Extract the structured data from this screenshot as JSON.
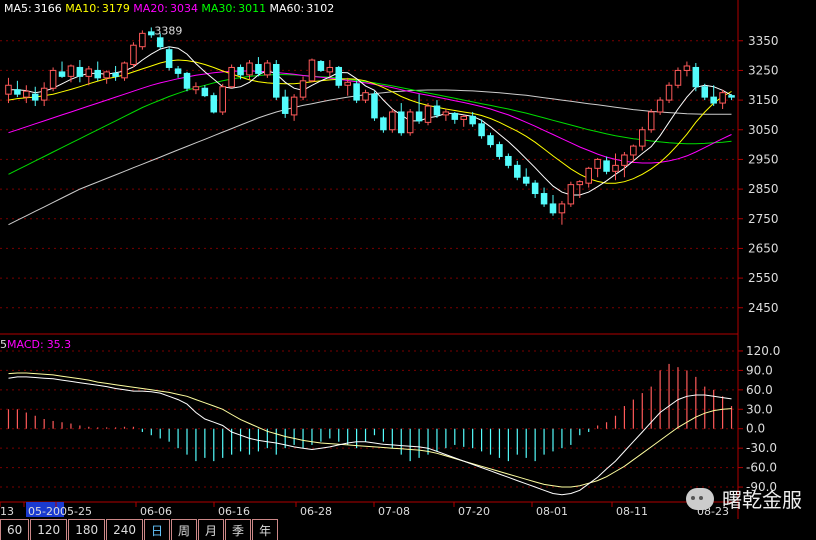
{
  "ma_legend": [
    {
      "label": "MA5:",
      "value": "3166",
      "color": "#ffffff"
    },
    {
      "label": "MA10:",
      "value": "3179",
      "color": "#ffff00"
    },
    {
      "label": "MA20:",
      "value": "3034",
      "color": "#ff00ff"
    },
    {
      "label": "MA30:",
      "value": "3011",
      "color": "#00ff00"
    },
    {
      "label": "MA60:",
      "value": "3102",
      "color": "#ffffff"
    }
  ],
  "macd_legend": {
    "label": "MACD:",
    "value": "35.3",
    "color": "#ff00ff"
  },
  "macd_prefix": "5",
  "peak_label": "3389",
  "price_axis_labels": [
    "3350",
    "3250",
    "3150",
    "3050",
    "2950",
    "2850",
    "2750",
    "2650",
    "2550",
    "2450"
  ],
  "macd_axis_labels": [
    "120.0",
    "90.0",
    "60.0",
    "30.0",
    "0.0",
    "-30.0",
    "-60.0",
    "-90.0"
  ],
  "date_labels": [
    "13",
    "05-20",
    "05-25",
    "06-06",
    "06-16",
    "06-28",
    "07-08",
    "07-20",
    "08-01",
    "08-11",
    "08-23"
  ],
  "selected_date": "05-20",
  "tabs": [
    "60",
    "120",
    "180",
    "240",
    "日",
    "周",
    "月",
    "季",
    "年"
  ],
  "active_tab": "日",
  "watermark": "曙乾金服",
  "colors": {
    "up": "#ff5a5a",
    "down": "#54fcfc",
    "grid": "#7a0000",
    "axis": "#b00000",
    "axis_text": "#dddddd"
  },
  "chart_data": {
    "type": "candlestick",
    "price_range": [
      2375,
      3420
    ],
    "macd_range": [
      -110,
      140
    ],
    "candles": [
      [
        3170,
        3225,
        3140,
        3200
      ],
      [
        3185,
        3215,
        3160,
        3170
      ],
      [
        3160,
        3200,
        3140,
        3180
      ],
      [
        3170,
        3195,
        3130,
        3150
      ],
      [
        3150,
        3210,
        3130,
        3190
      ],
      [
        3190,
        3260,
        3180,
        3250
      ],
      [
        3245,
        3280,
        3225,
        3230
      ],
      [
        3230,
        3270,
        3210,
        3265
      ],
      [
        3260,
        3285,
        3210,
        3230
      ],
      [
        3230,
        3265,
        3200,
        3255
      ],
      [
        3250,
        3280,
        3215,
        3225
      ],
      [
        3225,
        3250,
        3205,
        3245
      ],
      [
        3240,
        3265,
        3215,
        3230
      ],
      [
        3225,
        3280,
        3215,
        3275
      ],
      [
        3270,
        3345,
        3260,
        3335
      ],
      [
        3330,
        3385,
        3320,
        3375
      ],
      [
        3380,
        3395,
        3360,
        3370
      ],
      [
        3360,
        3375,
        3320,
        3330
      ],
      [
        3320,
        3330,
        3250,
        3260
      ],
      [
        3255,
        3265,
        3225,
        3240
      ],
      [
        3240,
        3245,
        3180,
        3190
      ],
      [
        3185,
        3210,
        3170,
        3195
      ],
      [
        3190,
        3200,
        3160,
        3165
      ],
      [
        3165,
        3175,
        3105,
        3110
      ],
      [
        3110,
        3205,
        3100,
        3195
      ],
      [
        3195,
        3270,
        3190,
        3260
      ],
      [
        3260,
        3270,
        3220,
        3235
      ],
      [
        3235,
        3285,
        3220,
        3275
      ],
      [
        3270,
        3295,
        3230,
        3240
      ],
      [
        3235,
        3285,
        3225,
        3275
      ],
      [
        3270,
        3285,
        3150,
        3160
      ],
      [
        3160,
        3185,
        3090,
        3105
      ],
      [
        3100,
        3170,
        3080,
        3160
      ],
      [
        3160,
        3230,
        3150,
        3215
      ],
      [
        3215,
        3290,
        3210,
        3285
      ],
      [
        3280,
        3285,
        3245,
        3250
      ],
      [
        3245,
        3285,
        3230,
        3260
      ],
      [
        3260,
        3265,
        3190,
        3200
      ],
      [
        3200,
        3225,
        3165,
        3210
      ],
      [
        3205,
        3215,
        3140,
        3150
      ],
      [
        3150,
        3185,
        3140,
        3175
      ],
      [
        3170,
        3180,
        3080,
        3090
      ],
      [
        3090,
        3095,
        3040,
        3050
      ],
      [
        3050,
        3120,
        3040,
        3110
      ],
      [
        3110,
        3140,
        3030,
        3040
      ],
      [
        3040,
        3120,
        3030,
        3110
      ],
      [
        3110,
        3170,
        3070,
        3080
      ],
      [
        3075,
        3140,
        3065,
        3130
      ],
      [
        3130,
        3150,
        3090,
        3100
      ],
      [
        3100,
        3120,
        3080,
        3110
      ],
      [
        3105,
        3110,
        3070,
        3085
      ],
      [
        3085,
        3100,
        3060,
        3095
      ],
      [
        3095,
        3110,
        3060,
        3070
      ],
      [
        3070,
        3085,
        3020,
        3030
      ],
      [
        3030,
        3040,
        2990,
        3000
      ],
      [
        3000,
        3010,
        2950,
        2960
      ],
      [
        2960,
        2970,
        2920,
        2930
      ],
      [
        2930,
        2945,
        2880,
        2890
      ],
      [
        2890,
        2920,
        2860,
        2870
      ],
      [
        2870,
        2880,
        2820,
        2835
      ],
      [
        2835,
        2855,
        2790,
        2800
      ],
      [
        2800,
        2830,
        2760,
        2770
      ],
      [
        2770,
        2810,
        2730,
        2800
      ],
      [
        2800,
        2875,
        2790,
        2865
      ],
      [
        2865,
        2880,
        2820,
        2875
      ],
      [
        2870,
        2925,
        2855,
        2920
      ],
      [
        2920,
        2955,
        2890,
        2950
      ],
      [
        2945,
        2960,
        2900,
        2910
      ],
      [
        2910,
        2970,
        2880,
        2930
      ],
      [
        2930,
        2975,
        2890,
        2965
      ],
      [
        2965,
        3000,
        2940,
        2995
      ],
      [
        2995,
        3060,
        2980,
        3050
      ],
      [
        3050,
        3120,
        3040,
        3110
      ],
      [
        3110,
        3160,
        3100,
        3150
      ],
      [
        3150,
        3210,
        3140,
        3200
      ],
      [
        3200,
        3260,
        3190,
        3250
      ],
      [
        3250,
        3280,
        3230,
        3265
      ],
      [
        3260,
        3275,
        3180,
        3195
      ],
      [
        3195,
        3205,
        3150,
        3160
      ],
      [
        3160,
        3200,
        3130,
        3140
      ],
      [
        3140,
        3185,
        3120,
        3175
      ],
      [
        3165,
        3170,
        3150,
        3160
      ]
    ],
    "ma5": [
      3185,
      3185,
      3182,
      3175,
      3180,
      3190,
      3205,
      3220,
      3232,
      3240,
      3240,
      3237,
      3242,
      3248,
      3262,
      3285,
      3305,
      3322,
      3330,
      3325,
      3305,
      3273,
      3245,
      3220,
      3195,
      3190,
      3195,
      3210,
      3235,
      3250,
      3238,
      3210,
      3190,
      3183,
      3200,
      3215,
      3228,
      3243,
      3242,
      3222,
      3198,
      3183,
      3150,
      3120,
      3100,
      3080,
      3080,
      3090,
      3095,
      3105,
      3105,
      3100,
      3095,
      3082,
      3060,
      3035,
      3010,
      2982,
      2952,
      2922,
      2890,
      2860,
      2840,
      2830,
      2830,
      2840,
      2858,
      2878,
      2900,
      2920,
      2945,
      2970,
      2993,
      3030,
      3075,
      3120,
      3160,
      3193,
      3200,
      3195,
      3183,
      3166
    ],
    "ma10": [
      3150,
      3155,
      3158,
      3160,
      3165,
      3170,
      3178,
      3186,
      3195,
      3205,
      3214,
      3222,
      3228,
      3235,
      3245,
      3255,
      3265,
      3275,
      3282,
      3285,
      3283,
      3278,
      3270,
      3260,
      3248,
      3238,
      3228,
      3218,
      3212,
      3208,
      3206,
      3205,
      3205,
      3208,
      3212,
      3215,
      3218,
      3220,
      3222,
      3220,
      3215,
      3205,
      3192,
      3178,
      3162,
      3150,
      3140,
      3132,
      3126,
      3120,
      3115,
      3110,
      3105,
      3098,
      3088,
      3075,
      3060,
      3045,
      3028,
      3008,
      2985,
      2962,
      2940,
      2918,
      2900,
      2885,
      2876,
      2870,
      2870,
      2875,
      2885,
      2900,
      2918,
      2940,
      2968,
      3000,
      3035,
      3075,
      3110,
      3140,
      3162,
      3179
    ],
    "ma20": [
      3040,
      3050,
      3060,
      3070,
      3080,
      3090,
      3100,
      3110,
      3120,
      3130,
      3140,
      3150,
      3160,
      3170,
      3180,
      3190,
      3200,
      3208,
      3215,
      3222,
      3228,
      3234,
      3238,
      3242,
      3245,
      3247,
      3248,
      3248,
      3247,
      3245,
      3243,
      3240,
      3237,
      3233,
      3230,
      3227,
      3224,
      3220,
      3216,
      3212,
      3208,
      3203,
      3198,
      3192,
      3185,
      3178,
      3172,
      3166,
      3160,
      3154,
      3148,
      3142,
      3135,
      3128,
      3120,
      3110,
      3100,
      3088,
      3075,
      3062,
      3048,
      3034,
      3020,
      3006,
      2992,
      2980,
      2968,
      2958,
      2950,
      2944,
      2940,
      2938,
      2938,
      2940,
      2945,
      2952,
      2962,
      2975,
      2990,
      3005,
      3020,
      3034
    ],
    "ma30": [
      2900,
      2915,
      2930,
      2945,
      2960,
      2975,
      2990,
      3005,
      3020,
      3035,
      3050,
      3065,
      3080,
      3095,
      3110,
      3125,
      3138,
      3150,
      3162,
      3173,
      3183,
      3192,
      3200,
      3208,
      3215,
      3221,
      3226,
      3230,
      3233,
      3235,
      3236,
      3236,
      3235,
      3233,
      3231,
      3229,
      3227,
      3224,
      3220,
      3216,
      3212,
      3208,
      3203,
      3198,
      3192,
      3186,
      3180,
      3174,
      3168,
      3162,
      3156,
      3150,
      3144,
      3138,
      3132,
      3126,
      3120,
      3113,
      3106,
      3098,
      3090,
      3082,
      3074,
      3066,
      3058,
      3050,
      3043,
      3036,
      3030,
      3025,
      3020,
      3016,
      3012,
      3009,
      3006,
      3004,
      3003,
      3003,
      3004,
      3006,
      3008,
      3011
    ],
    "ma60": [
      2730,
      2745,
      2760,
      2775,
      2790,
      2805,
      2820,
      2835,
      2850,
      2862,
      2874,
      2886,
      2898,
      2910,
      2922,
      2934,
      2946,
      2958,
      2970,
      2982,
      2994,
      3006,
      3018,
      3030,
      3042,
      3054,
      3066,
      3078,
      3090,
      3100,
      3110,
      3118,
      3125,
      3132,
      3138,
      3144,
      3150,
      3155,
      3160,
      3164,
      3168,
      3172,
      3175,
      3178,
      3180,
      3182,
      3183,
      3184,
      3184,
      3184,
      3183,
      3182,
      3181,
      3179,
      3177,
      3175,
      3172,
      3169,
      3166,
      3162,
      3158,
      3154,
      3150,
      3146,
      3142,
      3138,
      3134,
      3130,
      3126,
      3122,
      3118,
      3115,
      3112,
      3110,
      3108,
      3106,
      3104,
      3103,
      3102,
      3102,
      3102,
      3102
    ],
    "macd_bars": [
      30,
      30,
      25,
      20,
      15,
      12,
      10,
      8,
      5,
      3,
      2,
      2,
      2,
      3,
      3,
      -5,
      -10,
      -15,
      -20,
      -30,
      -40,
      -50,
      -45,
      -50,
      -45,
      -40,
      -35,
      -40,
      -35,
      -30,
      -40,
      -30,
      -25,
      -30,
      -25,
      -20,
      -15,
      -20,
      -25,
      -30,
      -20,
      -10,
      -20,
      -30,
      -40,
      -50,
      -45,
      -40,
      -35,
      -30,
      -25,
      -28,
      -30,
      -35,
      -40,
      -45,
      -50,
      -40,
      -45,
      -50,
      -40,
      -35,
      -30,
      -25,
      -10,
      -5,
      5,
      10,
      20,
      35,
      45,
      55,
      65,
      90,
      100,
      95,
      90,
      80,
      65,
      60,
      50,
      35
    ],
    "dif": [
      78,
      80,
      80,
      79,
      78,
      77,
      75,
      73,
      71,
      69,
      67,
      65,
      62,
      60,
      58,
      58,
      57,
      55,
      50,
      45,
      38,
      25,
      15,
      10,
      5,
      -5,
      -10,
      -15,
      -18,
      -20,
      -22,
      -25,
      -28,
      -30,
      -32,
      -30,
      -28,
      -25,
      -22,
      -20,
      -20,
      -22,
      -24,
      -25,
      -26,
      -27,
      -28,
      -30,
      -35,
      -40,
      -45,
      -50,
      -55,
      -60,
      -65,
      -70,
      -75,
      -80,
      -85,
      -90,
      -95,
      -100,
      -102,
      -100,
      -95,
      -85,
      -75,
      -62,
      -50,
      -35,
      -20,
      -5,
      10,
      25,
      35,
      45,
      50,
      52,
      52,
      50,
      48,
      46
    ],
    "dea": [
      85,
      86,
      86,
      85,
      84,
      83,
      81,
      79,
      77,
      75,
      72,
      70,
      68,
      66,
      64,
      62,
      60,
      58,
      56,
      53,
      50,
      45,
      40,
      35,
      30,
      22,
      14,
      8,
      2,
      -4,
      -8,
      -12,
      -15,
      -18,
      -20,
      -22,
      -23,
      -24,
      -25,
      -26,
      -27,
      -28,
      -29,
      -30,
      -31,
      -32,
      -33,
      -35,
      -38,
      -42,
      -46,
      -50,
      -54,
      -58,
      -62,
      -66,
      -70,
      -74,
      -78,
      -82,
      -86,
      -88,
      -90,
      -90,
      -88,
      -84,
      -80,
      -74,
      -66,
      -58,
      -48,
      -38,
      -28,
      -18,
      -8,
      2,
      10,
      18,
      24,
      28,
      30,
      31
    ]
  }
}
